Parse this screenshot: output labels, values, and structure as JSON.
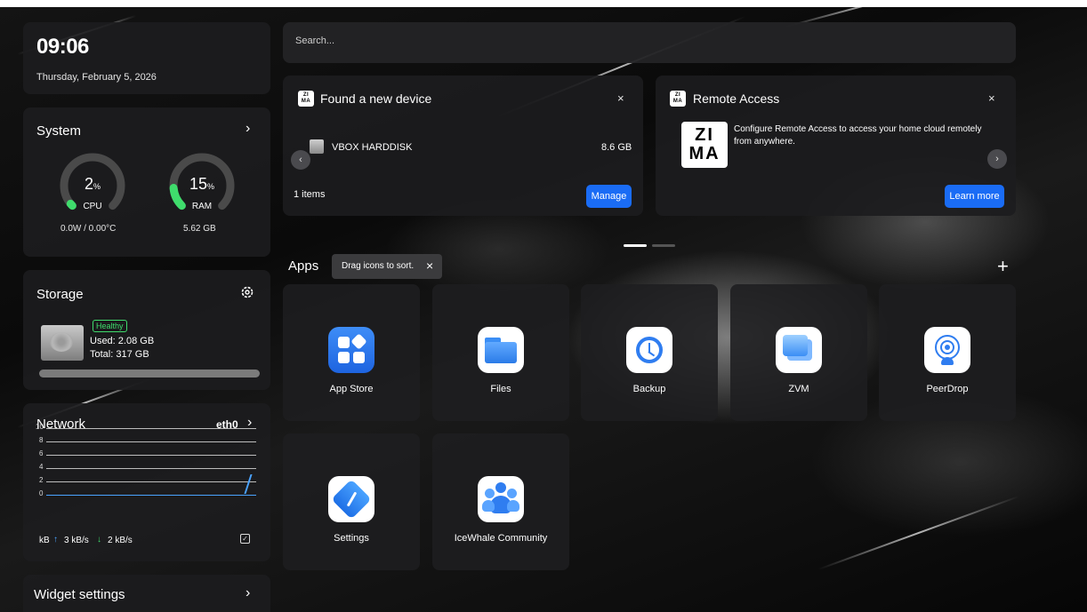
{
  "clock": {
    "time": "09:06",
    "date": "Thursday, February 5, 2026"
  },
  "system": {
    "title": "System",
    "cpu": {
      "value": "2",
      "unit": "%",
      "label": "CPU",
      "detail": "0.0W / 0.00°C",
      "percent": 2
    },
    "ram": {
      "value": "15",
      "unit": "%",
      "label": "RAM",
      "detail": "5.62 GB",
      "percent": 15
    },
    "gauge_color": "#3fdc6c"
  },
  "storage": {
    "title": "Storage",
    "status": "Healthy",
    "used": "Used: 2.08 GB",
    "total": "Total: 317 GB",
    "used_fraction": 0.0066
  },
  "network": {
    "title": "Network",
    "interface": "eth0",
    "y_ticks": [
      "10",
      "8",
      "6",
      "4",
      "2",
      "0"
    ],
    "unit": "kB",
    "upload": "3 kB/s",
    "download": "2 kB/s"
  },
  "widget_settings": {
    "label": "Widget settings"
  },
  "search": {
    "placeholder": "Search..."
  },
  "device_card": {
    "brand": "ZIMA",
    "title": "Found a new device",
    "device_name": "VBOX HARDDISK",
    "device_size": "8.6 GB",
    "count": "1 items",
    "button": "Manage"
  },
  "remote_card": {
    "brand": "ZIMA",
    "title": "Remote Access",
    "description": "Configure Remote Access to access your home cloud remotely from anywhere.",
    "button": "Learn more"
  },
  "apps": {
    "title": "Apps",
    "tooltip": "Drag icons to sort.",
    "items": [
      {
        "label": "App Store"
      },
      {
        "label": "Files"
      },
      {
        "label": "Backup"
      },
      {
        "label": "ZVM"
      },
      {
        "label": "PeerDrop"
      },
      {
        "label": "Settings"
      },
      {
        "label": "IceWhale Community"
      }
    ]
  },
  "accent_color": "#1a6cf5"
}
